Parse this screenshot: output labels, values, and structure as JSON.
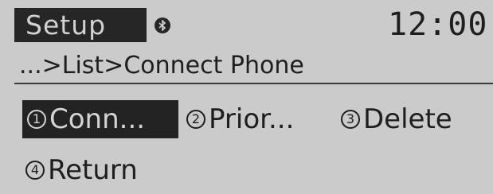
{
  "header": {
    "title": "Setup",
    "clock": "12:00"
  },
  "status": {
    "bluetooth_icon": "bluetooth-icon"
  },
  "breadcrumb": "...>List>Connect Phone",
  "menu": {
    "items": [
      {
        "number": "1",
        "label": "Conn...",
        "selected": true
      },
      {
        "number": "2",
        "label": "Prior..."
      },
      {
        "number": "3",
        "label": "Delete"
      },
      {
        "number": "4",
        "label": "Return"
      }
    ]
  },
  "colors": {
    "background": "#cbcbcb",
    "highlight": "#232323",
    "text": "#1e1e1e"
  }
}
